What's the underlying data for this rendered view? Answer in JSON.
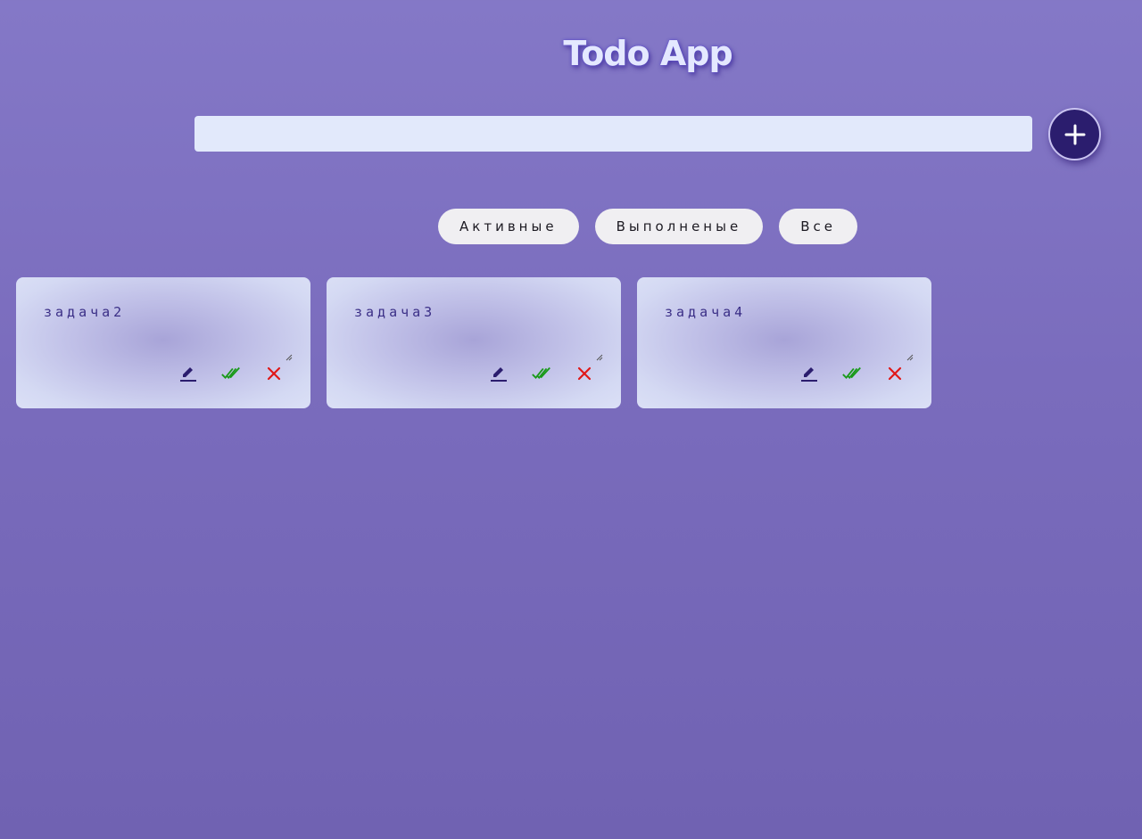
{
  "header": {
    "title": "Todo App"
  },
  "new_todo": {
    "value": "",
    "placeholder": "",
    "add_icon": "plus-icon"
  },
  "filters": [
    {
      "label": "Активные"
    },
    {
      "label": "Выполненые"
    },
    {
      "label": "Все"
    }
  ],
  "todos": [
    {
      "text": "задача2"
    },
    {
      "text": "задача3"
    },
    {
      "text": "задача4"
    }
  ],
  "icons": {
    "edit": "pencil-icon",
    "done": "double-check-icon",
    "delete": "close-icon"
  },
  "colors": {
    "background": "#7d70c2",
    "title": "#e4e8ff",
    "accent": "#2b1d6e",
    "input_bg": "#e2e9fb",
    "done_icon": "#1a9a1a",
    "delete_icon": "#e01818"
  }
}
